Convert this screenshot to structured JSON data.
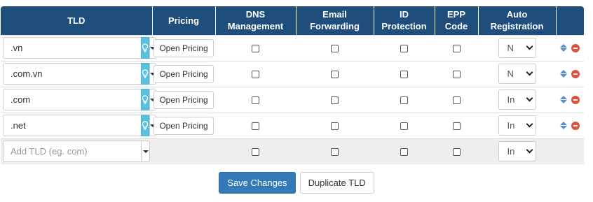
{
  "columns": {
    "tld": "TLD",
    "pricing": "Pricing",
    "dns_line1": "DNS",
    "dns_line2": "Management",
    "email_line1": "Email",
    "email_line2": "Forwarding",
    "id_line1": "ID",
    "id_line2": "Protection",
    "epp_line1": "EPP",
    "epp_line2": "Code",
    "auto_line1": "Auto",
    "auto_line2": "Registration"
  },
  "rows": [
    {
      "tld": ".vn",
      "pricing_label": "Open Pricing",
      "dns": false,
      "email": false,
      "id_protection": false,
      "epp": false,
      "auto_registration": "N"
    },
    {
      "tld": ".com.vn",
      "pricing_label": "Open Pricing",
      "dns": false,
      "email": false,
      "id_protection": false,
      "epp": false,
      "auto_registration": "N"
    },
    {
      "tld": ".com",
      "pricing_label": "Open Pricing",
      "dns": false,
      "email": false,
      "id_protection": false,
      "epp": false,
      "auto_registration": "In"
    },
    {
      "tld": ".net",
      "pricing_label": "Open Pricing",
      "dns": false,
      "email": false,
      "id_protection": false,
      "epp": false,
      "auto_registration": "In"
    }
  ],
  "new_row": {
    "placeholder": "Add TLD (eg. com)",
    "auto_registration": "In"
  },
  "buttons": {
    "save": "Save Changes",
    "duplicate": "Duplicate TLD"
  },
  "icons": {
    "suggest": "lightbulb-icon",
    "dropdown": "caret-down-icon",
    "sort": "sort-icon",
    "remove": "minus-circle-icon"
  },
  "colors": {
    "header_bg": "#1f4e7d",
    "suggest_btn": "#5bc0de",
    "primary_btn": "#337ab7",
    "remove": "#e0503e",
    "sort": "#5a8fd6"
  }
}
